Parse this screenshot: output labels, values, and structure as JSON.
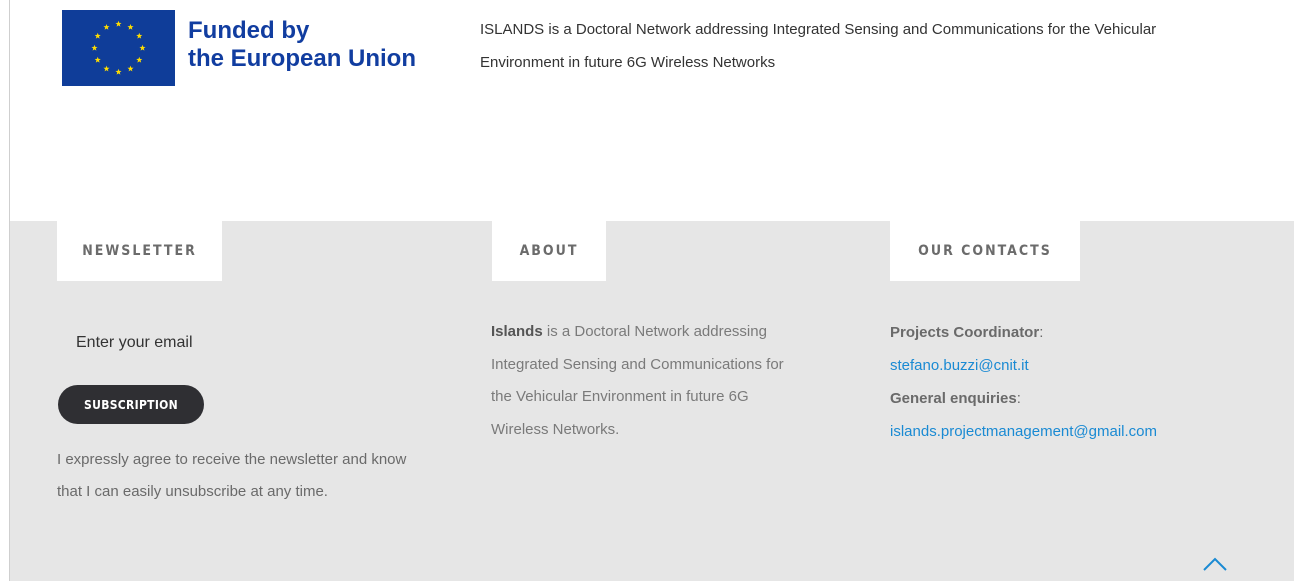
{
  "banner": {
    "eu_line1": "Funded by",
    "eu_line2": "the European Union",
    "description": "ISLANDS is a Doctoral Network addressing Integrated Sensing and Communications for the Vehicular Environment in future 6G Wireless Networks",
    "flag_icon": "eu-flag-icon",
    "flag_color": "#0f3d99",
    "star_color": "#ffdd00",
    "text_color": "#113da0"
  },
  "newsletter": {
    "heading": "NEWSLETTER",
    "email_placeholder": "Enter your email",
    "button_label": "SUBSCRIPTION",
    "consent": "I expressly agree to receive the newsletter and know that I can easily unsubscribe at any time."
  },
  "about": {
    "heading": "ABOUT",
    "bold": "Islands",
    "text": " is a Doctoral Network addressing Integrated Sensing and Communications for the Vehicular Environment in future 6G Wireless Networks."
  },
  "contacts": {
    "heading": "OUR CONTACTS",
    "coordinator_label": "Projects Coordinator",
    "coordinator_email": "stefano.buzzi@cnit.it",
    "enquiries_label": "General enquiries",
    "enquiries_email": "islands.projectmanagement@gmail.com",
    "link_color": "#1a8ad3"
  },
  "footer": {
    "background": "#e6e6e6",
    "scroll_top_icon": "chevron-up-icon"
  }
}
